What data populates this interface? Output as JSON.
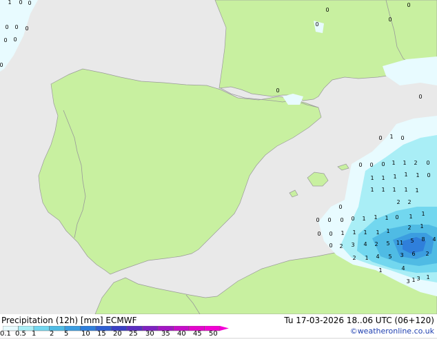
{
  "title": "Precipitation (12h) [mm] ECMWF",
  "datetime": "Tu 17-03-2026 18..06 UTC (06+120)",
  "credit": "©weatheronline.co.uk",
  "colors": {
    "sea": "#e9e9e9",
    "land": "#c8f0a0",
    "border": "#999999",
    "scale": [
      "#e8fbff",
      "#a9eef6",
      "#72d7ef",
      "#4fbbe4",
      "#3b9de0",
      "#2f7fdb",
      "#2e5fd2",
      "#3a3fc4",
      "#5a2fc0",
      "#7e22c0",
      "#a317c4",
      "#c60ec8",
      "#e405cc",
      "#f300d4"
    ]
  },
  "scale_labels": [
    "0.1",
    "0.5",
    "1",
    "2",
    "5",
    "10",
    "15",
    "20",
    "25",
    "30",
    "35",
    "40",
    "45",
    "50"
  ],
  "precip_values": [
    {
      "v": "1"
    },
    {
      "v": "0"
    },
    {
      "v": "0"
    },
    {
      "v": "0"
    },
    {
      "v": "0"
    },
    {
      "v": "0"
    },
    {
      "v": "0"
    },
    {
      "v": "0"
    },
    {
      "v": "0"
    },
    {
      "v": "0"
    },
    {
      "v": "0"
    },
    {
      "v": "0"
    },
    {
      "v": "0"
    },
    {
      "v": "0"
    },
    {
      "v": "0"
    },
    {
      "v": "0"
    },
    {
      "v": "1"
    },
    {
      "v": "0"
    },
    {
      "v": "0"
    },
    {
      "v": "0"
    },
    {
      "v": "0"
    },
    {
      "v": "1"
    },
    {
      "v": "1"
    },
    {
      "v": "2"
    },
    {
      "v": "0"
    },
    {
      "v": "1"
    },
    {
      "v": "1"
    },
    {
      "v": "1"
    },
    {
      "v": "1"
    },
    {
      "v": "1"
    },
    {
      "v": "0"
    },
    {
      "v": "1"
    },
    {
      "v": "1"
    },
    {
      "v": "1"
    },
    {
      "v": "1"
    },
    {
      "v": "1"
    },
    {
      "v": "2"
    },
    {
      "v": "2"
    },
    {
      "v": "0"
    },
    {
      "v": "0"
    },
    {
      "v": "0"
    },
    {
      "v": "0"
    },
    {
      "v": "0"
    },
    {
      "v": "1"
    },
    {
      "v": "1"
    },
    {
      "v": "1"
    },
    {
      "v": "0"
    },
    {
      "v": "1"
    },
    {
      "v": "1"
    },
    {
      "v": "0"
    },
    {
      "v": "0"
    },
    {
      "v": "1"
    },
    {
      "v": "1"
    },
    {
      "v": "1"
    },
    {
      "v": "1"
    },
    {
      "v": "1"
    },
    {
      "v": "2"
    },
    {
      "v": "1"
    },
    {
      "v": "0"
    },
    {
      "v": "2"
    },
    {
      "v": "3"
    },
    {
      "v": "4"
    },
    {
      "v": "2"
    },
    {
      "v": "5"
    },
    {
      "v": "11"
    },
    {
      "v": "5"
    },
    {
      "v": "8"
    },
    {
      "v": "4"
    },
    {
      "v": "2"
    },
    {
      "v": "1"
    },
    {
      "v": "4"
    },
    {
      "v": "5"
    },
    {
      "v": "3"
    },
    {
      "v": "6"
    },
    {
      "v": "2"
    },
    {
      "v": "1"
    },
    {
      "v": "4"
    },
    {
      "v": "1"
    },
    {
      "v": "1"
    },
    {
      "v": "3"
    },
    {
      "v": "3"
    }
  ]
}
